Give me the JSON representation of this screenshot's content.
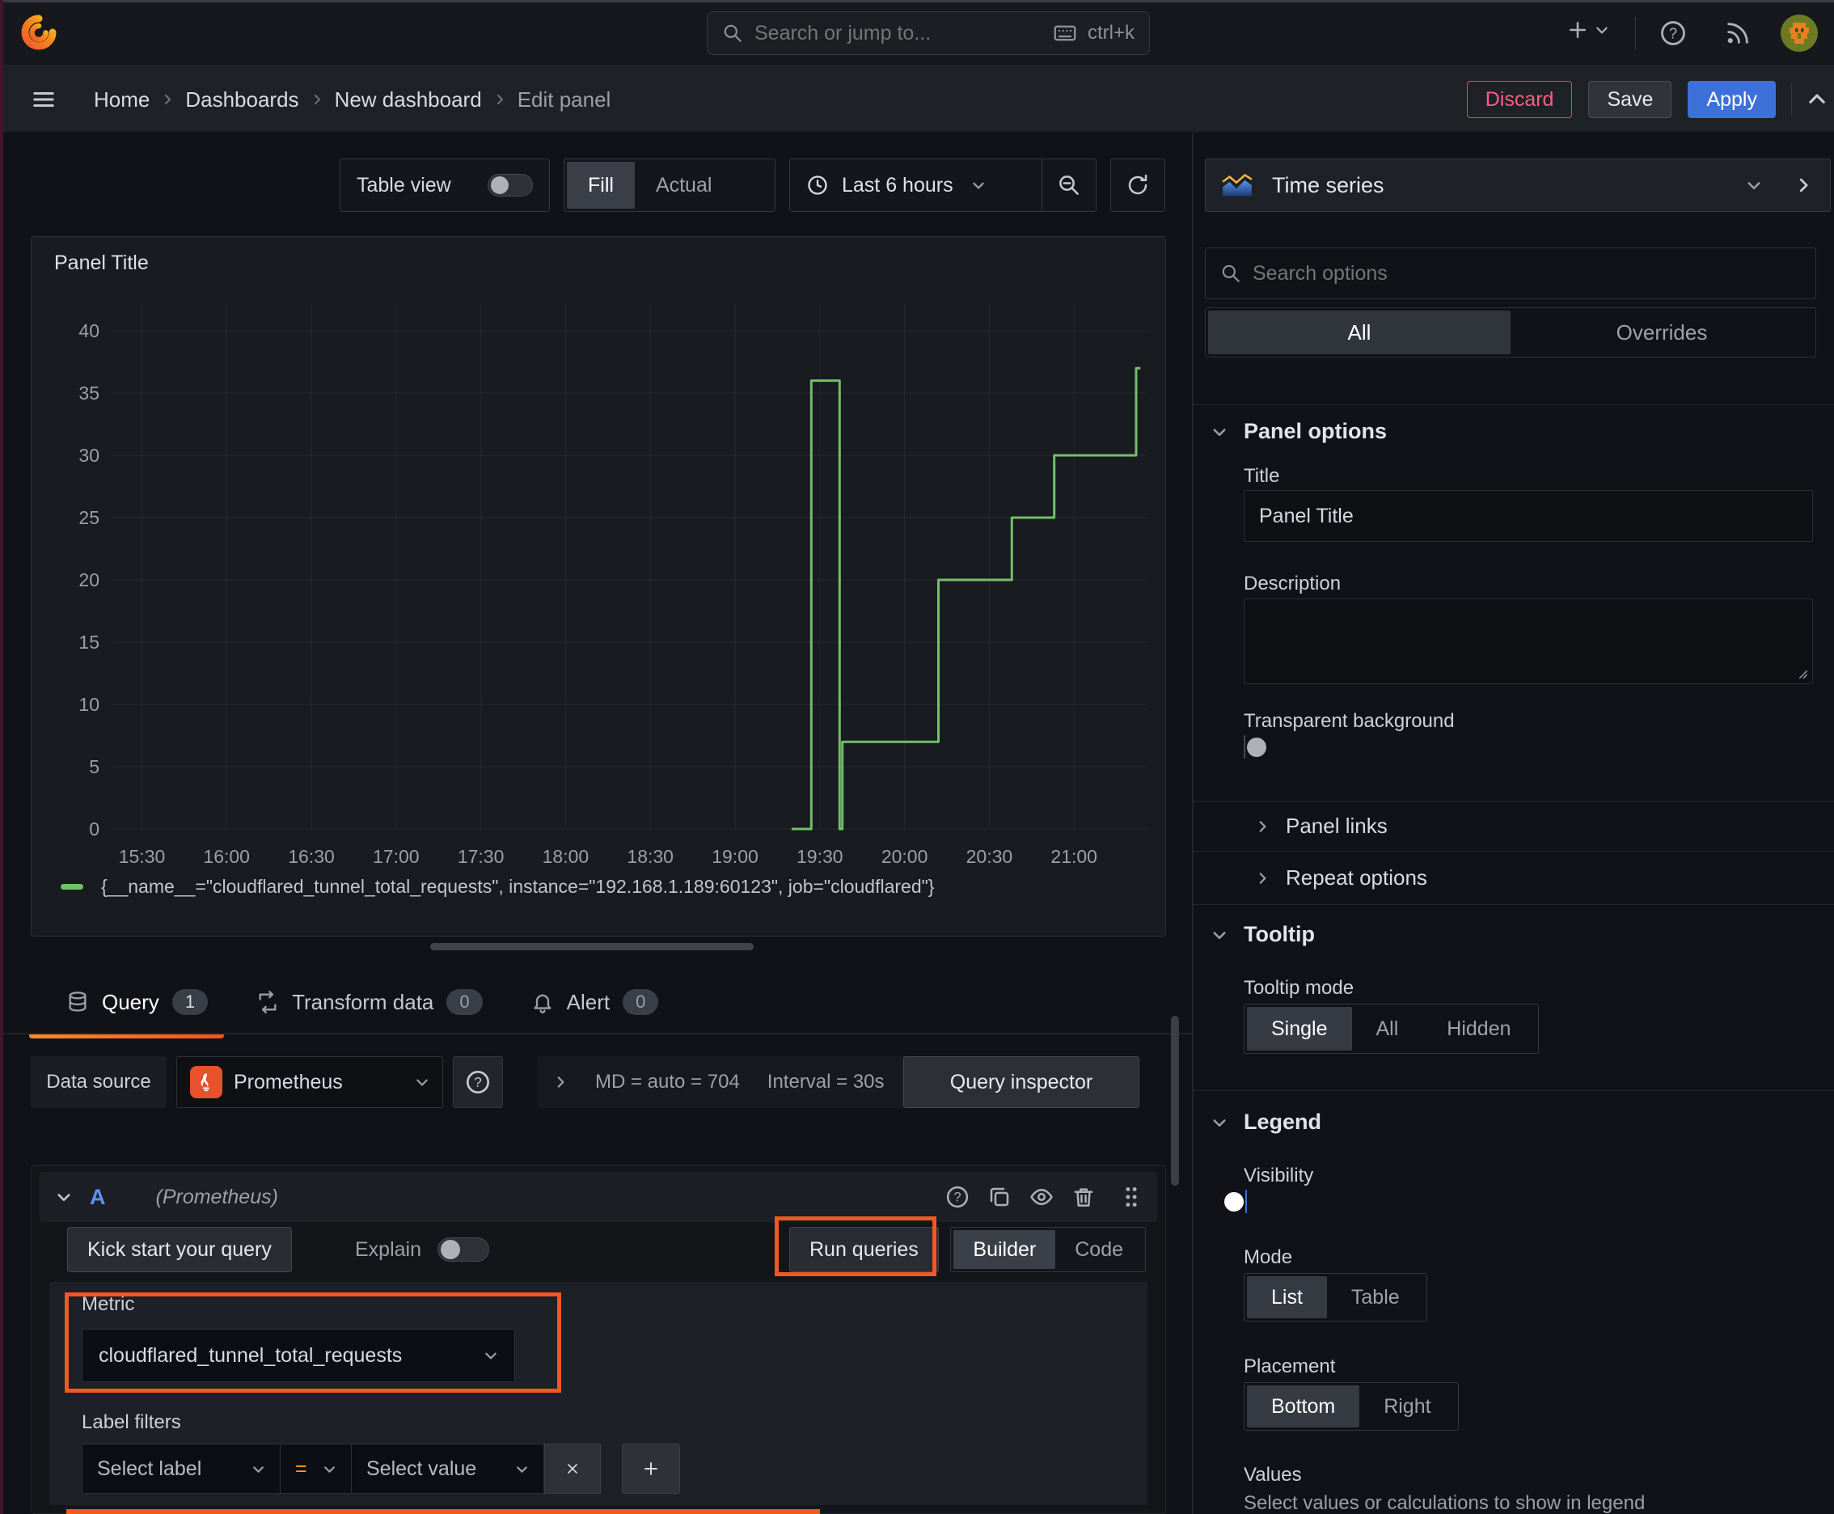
{
  "topbar": {
    "search_placeholder": "Search or jump to...",
    "shortcut": "ctrl+k"
  },
  "breadcrumb": {
    "items": [
      "Home",
      "Dashboards",
      "New dashboard",
      "Edit panel"
    ]
  },
  "actions": {
    "discard": "Discard",
    "save": "Save",
    "apply": "Apply"
  },
  "toolbar": {
    "table_view": "Table view",
    "fill": "Fill",
    "actual": "Actual",
    "time_range": "Last 6 hours"
  },
  "viz_picker": {
    "label": "Time series"
  },
  "panel": {
    "title": "Panel Title"
  },
  "chart_data": {
    "type": "line",
    "title": "Panel Title",
    "x_ticks": [
      {
        "t": 0,
        "label": "15:30"
      },
      {
        "t": 30,
        "label": "16:00"
      },
      {
        "t": 60,
        "label": "16:30"
      },
      {
        "t": 90,
        "label": "17:00"
      },
      {
        "t": 120,
        "label": "17:30"
      },
      {
        "t": 150,
        "label": "18:00"
      },
      {
        "t": 180,
        "label": "18:30"
      },
      {
        "t": 210,
        "label": "19:00"
      },
      {
        "t": 240,
        "label": "19:30"
      },
      {
        "t": 270,
        "label": "20:00"
      },
      {
        "t": 300,
        "label": "20:30"
      },
      {
        "t": 330,
        "label": "21:00"
      }
    ],
    "x_range_minutes": [
      -7,
      356
    ],
    "y_ticks": [
      0,
      5,
      10,
      15,
      20,
      25,
      30,
      35,
      40
    ],
    "ylim": [
      0,
      40
    ],
    "grid": true,
    "legend_position": "bottom",
    "series": [
      {
        "name": "{__name__=\"cloudflared_tunnel_total_requests\", instance=\"192.168.1.189:60123\", job=\"cloudflared\"}",
        "color": "#73bf69",
        "vertices": [
          [
            230,
            0
          ],
          [
            237,
            0
          ],
          [
            237,
            36
          ],
          [
            247,
            36
          ],
          [
            247,
            0
          ],
          [
            248,
            0
          ],
          [
            248,
            7
          ],
          [
            282,
            7
          ],
          [
            282,
            20
          ],
          [
            308,
            20
          ],
          [
            308,
            25
          ],
          [
            323,
            25
          ],
          [
            323,
            30
          ],
          [
            352,
            30
          ],
          [
            352,
            37
          ],
          [
            353.5,
            37
          ]
        ]
      }
    ]
  },
  "query_section": {
    "tabs": [
      {
        "label": "Query",
        "badge": "1"
      },
      {
        "label": "Transform data",
        "badge": "0"
      },
      {
        "label": "Alert",
        "badge": "0"
      }
    ],
    "datasource": {
      "label": "Data source",
      "name": "Prometheus",
      "stats": "MD = auto = 704",
      "interval": "Interval = 30s",
      "inspector": "Query inspector"
    },
    "query_row": {
      "ref": "A",
      "ds_hint": "(Prometheus)"
    },
    "builder": {
      "kickstart": "Kick start your query",
      "explain": "Explain",
      "run": "Run queries",
      "builder": "Builder",
      "code": "Code",
      "metric_label": "Metric",
      "metric_value": "cloudflared_tunnel_total_requests",
      "label_filters": "Label filters",
      "select_label": "Select label",
      "eq": "=",
      "select_value": "Select value"
    }
  },
  "options_pane": {
    "search_placeholder": "Search options",
    "tabs": {
      "all": "All",
      "overrides": "Overrides"
    },
    "panel_options": {
      "title": "Panel options",
      "title_label": "Title",
      "title_value": "Panel Title",
      "description_label": "Description",
      "transparent_label": "Transparent background"
    },
    "panel_links": "Panel links",
    "repeat_options": "Repeat options",
    "tooltip": {
      "title": "Tooltip",
      "mode_label": "Tooltip mode",
      "modes": [
        "Single",
        "All",
        "Hidden"
      ]
    },
    "legend": {
      "title": "Legend",
      "visibility_label": "Visibility",
      "mode_label": "Mode",
      "modes": [
        "List",
        "Table"
      ],
      "placement_label": "Placement",
      "placements": [
        "Bottom",
        "Right"
      ],
      "values_label": "Values",
      "values_desc": "Select values or calculations to show in legend"
    }
  }
}
